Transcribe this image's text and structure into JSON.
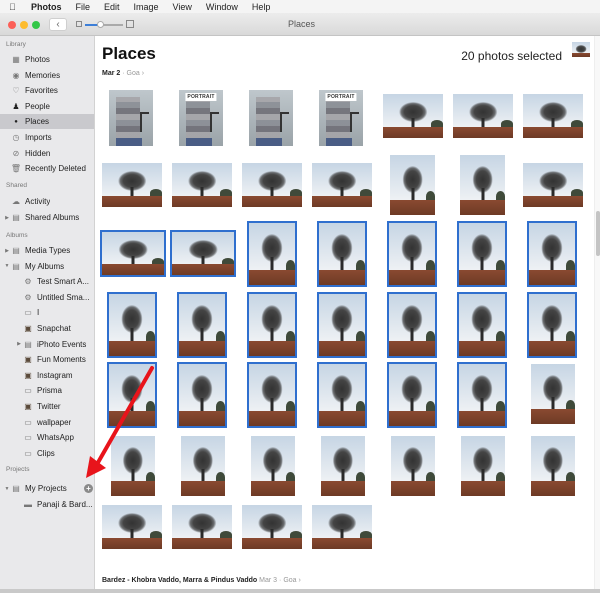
{
  "menubar": {
    "apple_icon": "apple-logo",
    "app_name": "Photos",
    "items": [
      "File",
      "Edit",
      "Image",
      "View",
      "Window",
      "Help"
    ]
  },
  "toolbar": {
    "window_title": "Places",
    "back_label": "‹",
    "traffic_colors": {
      "close": "#fc5f57",
      "minimize": "#fdbc2e",
      "zoom": "#33c748"
    },
    "zoom_level_fraction": 0.4
  },
  "sidebar": {
    "sections": [
      {
        "title": "Library",
        "items": [
          {
            "label": "Photos",
            "icon": "photos-grid-icon"
          },
          {
            "label": "Memories",
            "icon": "memories-play-icon"
          },
          {
            "label": "Favorites",
            "icon": "heart-icon"
          },
          {
            "label": "People",
            "icon": "person-icon"
          },
          {
            "label": "Places",
            "icon": "pin-icon",
            "selected": true
          },
          {
            "label": "Imports",
            "icon": "clock-icon"
          },
          {
            "label": "Hidden",
            "icon": "hidden-icon"
          },
          {
            "label": "Recently Deleted",
            "icon": "trash-icon"
          }
        ]
      },
      {
        "title": "Shared",
        "items": [
          {
            "label": "Activity",
            "icon": "cloud-icon"
          },
          {
            "label": "Shared Albums",
            "icon": "folder-icon",
            "disclosure": "collapsed"
          }
        ]
      },
      {
        "title": "Albums",
        "items": [
          {
            "label": "Media Types",
            "icon": "folder-icon",
            "disclosure": "collapsed"
          },
          {
            "label": "My Albums",
            "icon": "folder-icon",
            "disclosure": "expanded"
          },
          {
            "label": "Test Smart A...",
            "icon": "smart-album-gear-icon",
            "indent": 1
          },
          {
            "label": "Untitled Sma...",
            "icon": "smart-album-gear-icon",
            "indent": 1
          },
          {
            "label": "I",
            "icon": "album-icon",
            "indent": 1
          },
          {
            "label": "Snapchat",
            "icon": "album-thumb-icon",
            "indent": 1
          },
          {
            "label": "iPhoto Events",
            "icon": "folder-icon",
            "indent": 1,
            "disclosure": "collapsed"
          },
          {
            "label": "Fun Moments",
            "icon": "album-thumb-icon",
            "indent": 1
          },
          {
            "label": "Instagram",
            "icon": "album-thumb-icon",
            "indent": 1
          },
          {
            "label": "Prisma",
            "icon": "album-icon",
            "indent": 1
          },
          {
            "label": "Twitter",
            "icon": "album-thumb-icon",
            "indent": 1
          },
          {
            "label": "wallpaper",
            "icon": "album-icon",
            "indent": 1
          },
          {
            "label": "WhatsApp",
            "icon": "album-icon",
            "indent": 1
          },
          {
            "label": "Clips",
            "icon": "album-icon",
            "indent": 1
          }
        ]
      },
      {
        "title": "Projects",
        "items": [
          {
            "label": "My Projects",
            "icon": "folder-icon",
            "disclosure": "expanded",
            "add_button": "+"
          },
          {
            "label": "Panaji & Bard...",
            "icon": "project-book-icon",
            "indent": 1
          }
        ]
      }
    ]
  },
  "main": {
    "title": "Places",
    "selection_status": "20 photos selected",
    "groups": [
      {
        "date": "Mar 2",
        "separator": "·",
        "place": "Goa",
        "chevron": "›"
      },
      {
        "title": "Bardez - Khobra Vaddo, Marra & Pindus Vaddo",
        "date": "Mar 3",
        "separator": "·",
        "place": "Goa",
        "chevron": "›"
      }
    ],
    "portrait_badge": "PORTRAIT",
    "photos": [
      {
        "kind": "person",
        "selected": false,
        "badge": false
      },
      {
        "kind": "person",
        "selected": false,
        "badge": true
      },
      {
        "kind": "person",
        "selected": false,
        "badge": false
      },
      {
        "kind": "person",
        "selected": false,
        "badge": true
      },
      {
        "kind": "tree-landscape",
        "selected": false
      },
      {
        "kind": "tree-landscape",
        "selected": false
      },
      {
        "kind": "tree-landscape",
        "selected": false
      },
      {
        "kind": "tree-landscape",
        "selected": false
      },
      {
        "kind": "tree-landscape",
        "selected": false
      },
      {
        "kind": "tree-landscape",
        "selected": false
      },
      {
        "kind": "tree-landscape",
        "selected": false
      },
      {
        "kind": "tree-portrait",
        "selected": false
      },
      {
        "kind": "tree-portrait",
        "selected": false
      },
      {
        "kind": "tree-landscape",
        "selected": false
      },
      {
        "kind": "tree-landscape",
        "selected": true
      },
      {
        "kind": "tree-landscape",
        "selected": true
      },
      {
        "kind": "tree-portrait",
        "selected": true
      },
      {
        "kind": "tree-portrait",
        "selected": true
      },
      {
        "kind": "tree-portrait",
        "selected": true
      },
      {
        "kind": "tree-portrait",
        "selected": true
      },
      {
        "kind": "tree-portrait",
        "selected": true
      },
      {
        "kind": "tree-portrait",
        "selected": true
      },
      {
        "kind": "tree-portrait",
        "selected": true
      },
      {
        "kind": "tree-portrait",
        "selected": true
      },
      {
        "kind": "tree-portrait",
        "selected": true
      },
      {
        "kind": "tree-portrait",
        "selected": true
      },
      {
        "kind": "tree-portrait",
        "selected": true
      },
      {
        "kind": "tree-portrait",
        "selected": true
      },
      {
        "kind": "tree-portrait",
        "selected": true
      },
      {
        "kind": "tree-portrait",
        "selected": true
      },
      {
        "kind": "tree-portrait",
        "selected": true
      },
      {
        "kind": "tree-portrait",
        "selected": true
      },
      {
        "kind": "tree-portrait",
        "selected": true
      },
      {
        "kind": "tree-portrait",
        "selected": true
      },
      {
        "kind": "tree-portrait",
        "selected": false
      },
      {
        "kind": "tree-portrait",
        "selected": false
      },
      {
        "kind": "tree-portrait",
        "selected": false
      },
      {
        "kind": "tree-portrait",
        "selected": false
      },
      {
        "kind": "tree-portrait",
        "selected": false
      },
      {
        "kind": "tree-portrait",
        "selected": false
      },
      {
        "kind": "tree-portrait",
        "selected": false
      },
      {
        "kind": "tree-portrait",
        "selected": false
      },
      {
        "kind": "tree-landscape",
        "selected": false
      },
      {
        "kind": "tree-landscape",
        "selected": false
      },
      {
        "kind": "tree-landscape",
        "selected": false
      },
      {
        "kind": "tree-landscape",
        "selected": false
      }
    ]
  },
  "annotation": {
    "type": "red-arrow",
    "points_to": "My Projects add button",
    "color": "#e8141b"
  },
  "colors": {
    "selection": "#2f6fce",
    "sidebar_bg": "#e9e9eb",
    "sidebar_selected": "#c9c9cd"
  }
}
